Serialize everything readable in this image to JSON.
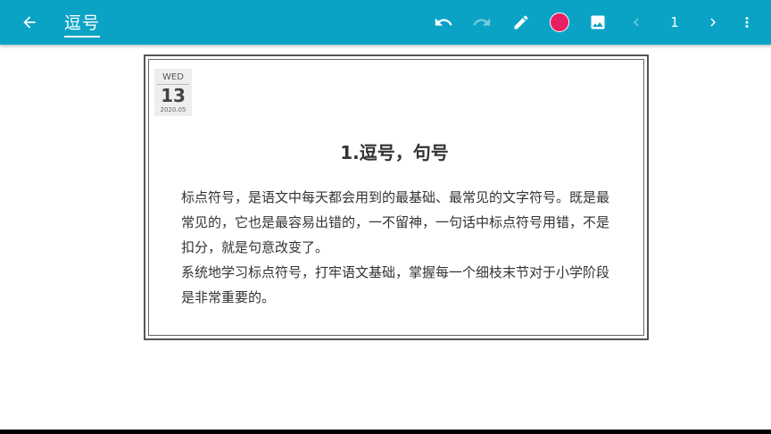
{
  "app": {
    "title": "逗号",
    "page_number": "1",
    "colors": {
      "appbar": "#0ba3c5",
      "pen_color": "#e91e63"
    },
    "icons": [
      "back-arrow-icon",
      "undo-icon",
      "redo-icon",
      "pencil-icon",
      "color-dot-icon",
      "image-icon",
      "chevron-left-icon",
      "chevron-right-icon",
      "more-vert-icon"
    ]
  },
  "card": {
    "date": {
      "weekday": "WED",
      "day": "13",
      "year_month": "2020.05"
    },
    "heading": "1.逗号，句号",
    "paragraphs": [
      "标点符号，是语文中每天都会用到的最基础、最常见的文字符号。既是最常见的，它也是最容易出错的，一不留神，一句话中标点符号用错，不是扣分，就是句意改变了。",
      "系统地学习标点符号，打牢语文基础，掌握每一个细枝末节对于小学阶段是非常重要的。"
    ]
  }
}
